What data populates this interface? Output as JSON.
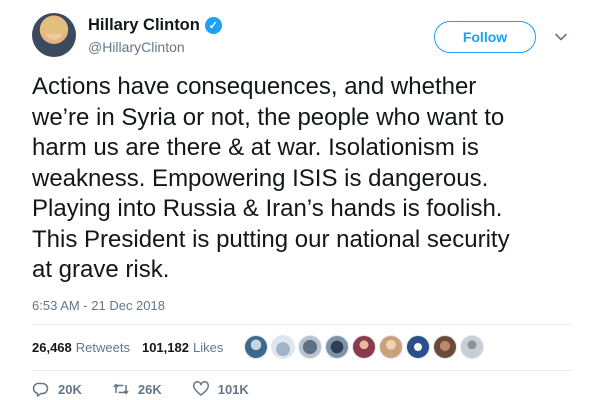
{
  "author": {
    "name": "Hillary Clinton",
    "handle": "@HillaryClinton",
    "verified_icon": "verified-badge-icon"
  },
  "follow_button": {
    "label": "Follow"
  },
  "tweet": {
    "text_lines": [
      "Actions have consequences, and whether",
      "we’re in Syria or not, the people who want to",
      "harm us are there & at war. Isolationism is",
      "weakness. Empowering ISIS is dangerous.",
      "Playing into Russia & Iran’s hands is foolish.",
      "This President is putting our national security",
      "at grave risk."
    ],
    "timestamp": "6:53 AM - 21 Dec 2018"
  },
  "stats": {
    "retweets_count": "26,468",
    "retweets_label": "Retweets",
    "likes_count": "101,182",
    "likes_label": "Likes"
  },
  "likers": [
    {
      "color": "#3b6a8c"
    },
    {
      "color": "#9fb4c8"
    },
    {
      "color": "#5d6f80"
    },
    {
      "color": "#2c3e55"
    },
    {
      "color": "#8a3a4a"
    },
    {
      "color": "#c9a27a"
    },
    {
      "color": "#2b4f8c"
    },
    {
      "color": "#6b4a3a"
    },
    {
      "color": "#c8ced4"
    }
  ],
  "actions": {
    "reply_count": "20K",
    "retweet_count": "26K",
    "like_count": "101K"
  },
  "colors": {
    "accent": "#1da1f2",
    "muted": "#657786",
    "text": "#14171a"
  }
}
